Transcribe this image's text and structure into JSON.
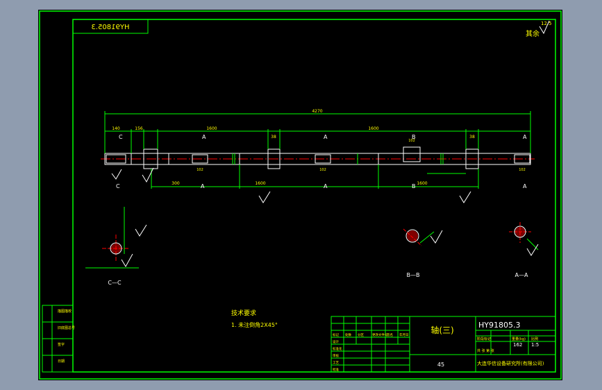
{
  "colors": {
    "background": "#8f9caf",
    "paper": "#000000",
    "border": "#00ff00",
    "dimension": "#00ff00",
    "text": "#ffff00",
    "outline": "#ffffff",
    "centerline": "#ff0000"
  },
  "title_block": {
    "part_name": "轴(三)",
    "drawing_no": "HY91805.3",
    "material": "45",
    "weight_label": "重量(kg)",
    "weight": "162",
    "scale_label": "比例",
    "scale": "1:5",
    "company": "大连华信设备研究所(有限公司)",
    "rev_headers": [
      "标记",
      "处数",
      "分区",
      "更改文件号",
      "签名",
      "年月日"
    ],
    "row_labels": [
      "设计",
      "标准化",
      "审核",
      "工艺",
      "批准"
    ],
    "stage_label": "阶段标记",
    "sheet_label": "共 张 第 张"
  },
  "mirrored_code": "HY91805.3",
  "roughness_note": "其余",
  "roughness_value": "12.5",
  "tech_requirements": {
    "title": "技术要求",
    "item1": "1. 未注倒角2X45°"
  },
  "dimensions": {
    "total_length": "4270",
    "segments": [
      "140",
      "156",
      "1600",
      "38",
      "1600",
      "38"
    ],
    "lower": [
      "300",
      "1600",
      "1600"
    ],
    "keyway_widths": [
      "102",
      "102",
      "102",
      "102"
    ]
  },
  "section_labels": {
    "c_top": "C",
    "a1_top": "A",
    "a2_top": "A",
    "b_top": "B",
    "a3_top": "A",
    "c_bottom": "C",
    "a1_bottom": "A",
    "a2_bottom": "A",
    "b_bottom": "B",
    "a3_bottom": "A"
  },
  "section_views": {
    "cc": "C—C",
    "bb": "B—B",
    "aa": "A—A"
  },
  "left_block": [
    "描图描校",
    "旧底图总号",
    "签字",
    "日期"
  ]
}
